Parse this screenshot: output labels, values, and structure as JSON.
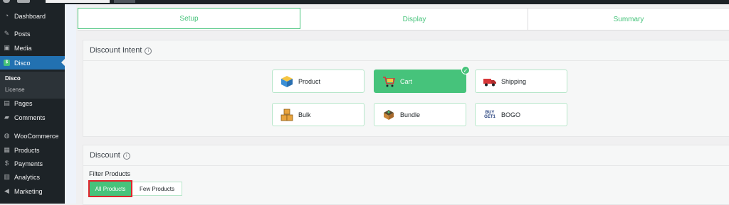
{
  "sidebar": {
    "items": [
      {
        "label": "Dashboard",
        "icon": "dashboard-icon"
      },
      {
        "label": "Posts",
        "icon": "pushpin-icon"
      },
      {
        "label": "Media",
        "icon": "media-icon"
      },
      {
        "label": "Disco",
        "icon": "disco-icon"
      },
      {
        "label": "Pages",
        "icon": "pages-icon"
      },
      {
        "label": "Comments",
        "icon": "comments-icon"
      },
      {
        "label": "WooCommerce",
        "icon": "woocommerce-icon"
      },
      {
        "label": "Products",
        "icon": "products-icon"
      },
      {
        "label": "Payments",
        "icon": "payments-icon"
      },
      {
        "label": "Analytics",
        "icon": "analytics-icon"
      },
      {
        "label": "Marketing",
        "icon": "marketing-icon"
      }
    ],
    "submenu": [
      "Disco",
      "License"
    ],
    "active_color": "#2271b1"
  },
  "tabs": [
    "Setup",
    "Display",
    "Summary"
  ],
  "intent": {
    "title": "Discount Intent",
    "options": [
      {
        "label": "Product",
        "icon": "box-icon"
      },
      {
        "label": "Cart",
        "icon": "cart-icon",
        "selected": true
      },
      {
        "label": "Shipping",
        "icon": "truck-icon"
      },
      {
        "label": "Bulk",
        "icon": "boxes-icon"
      },
      {
        "label": "Bundle",
        "icon": "bundle-icon"
      },
      {
        "label": "BOGO",
        "icon": "bogo-icon"
      }
    ]
  },
  "discount": {
    "title": "Discount",
    "filter_label": "Filter Products",
    "buttons": [
      "All Products",
      "Few Products"
    ]
  },
  "colors": {
    "accent": "#46c37b",
    "highlight": "#e0242b"
  }
}
